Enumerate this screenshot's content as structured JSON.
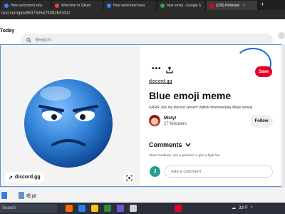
{
  "browser": {
    "tabs": [
      {
        "label": "How welcomed wou",
        "color": "#4285f4",
        "active": false
      },
      {
        "label": "Welcome to Qbuet",
        "color": "#ea4335",
        "active": false
      },
      {
        "label": "How welcomed wou",
        "color": "#4285f4",
        "active": false
      },
      {
        "label": "blue emoji - Google S",
        "color": "#34a853",
        "active": false
      },
      {
        "label": "(126) Pinterest",
        "color": "#e60023",
        "active": true
      }
    ],
    "new_tab": "+",
    "url": "rest.com/pin/860750547539263331/"
  },
  "header": {
    "today": "Today",
    "search_placeholder": "Search"
  },
  "pin": {
    "source_badge": "discord.gg",
    "more_label": "•••",
    "save_label": "Save",
    "link": "discord.gg",
    "title": "Blue emoji meme",
    "description": "GRRR Join my discord server!! #tiktok #memesdaily #blue #emoji",
    "user": {
      "name": "Misty!",
      "followers": "27 followers"
    },
    "follow_label": "Follow",
    "comments_heading": "Comments",
    "comments_hint": "Share feedback, ask a question or give a high five",
    "comment_avatar_letter": "J",
    "comment_placeholder": "Add a comment"
  },
  "downloads": {
    "file_name": "嗯.jfif"
  },
  "taskbar": {
    "search_placeholder": "Search",
    "temperature": "33°F",
    "colors": [
      "#ff6a00",
      "#2b7de9",
      "#f5c518",
      "#2c8c3c",
      "#6a5acd",
      "#d0d0d0",
      "#e60023"
    ]
  },
  "colors": {
    "pinterest_red": "#e60023",
    "emoji_blue": "#2f7fd6",
    "focus_blue": "#5a93d6"
  }
}
